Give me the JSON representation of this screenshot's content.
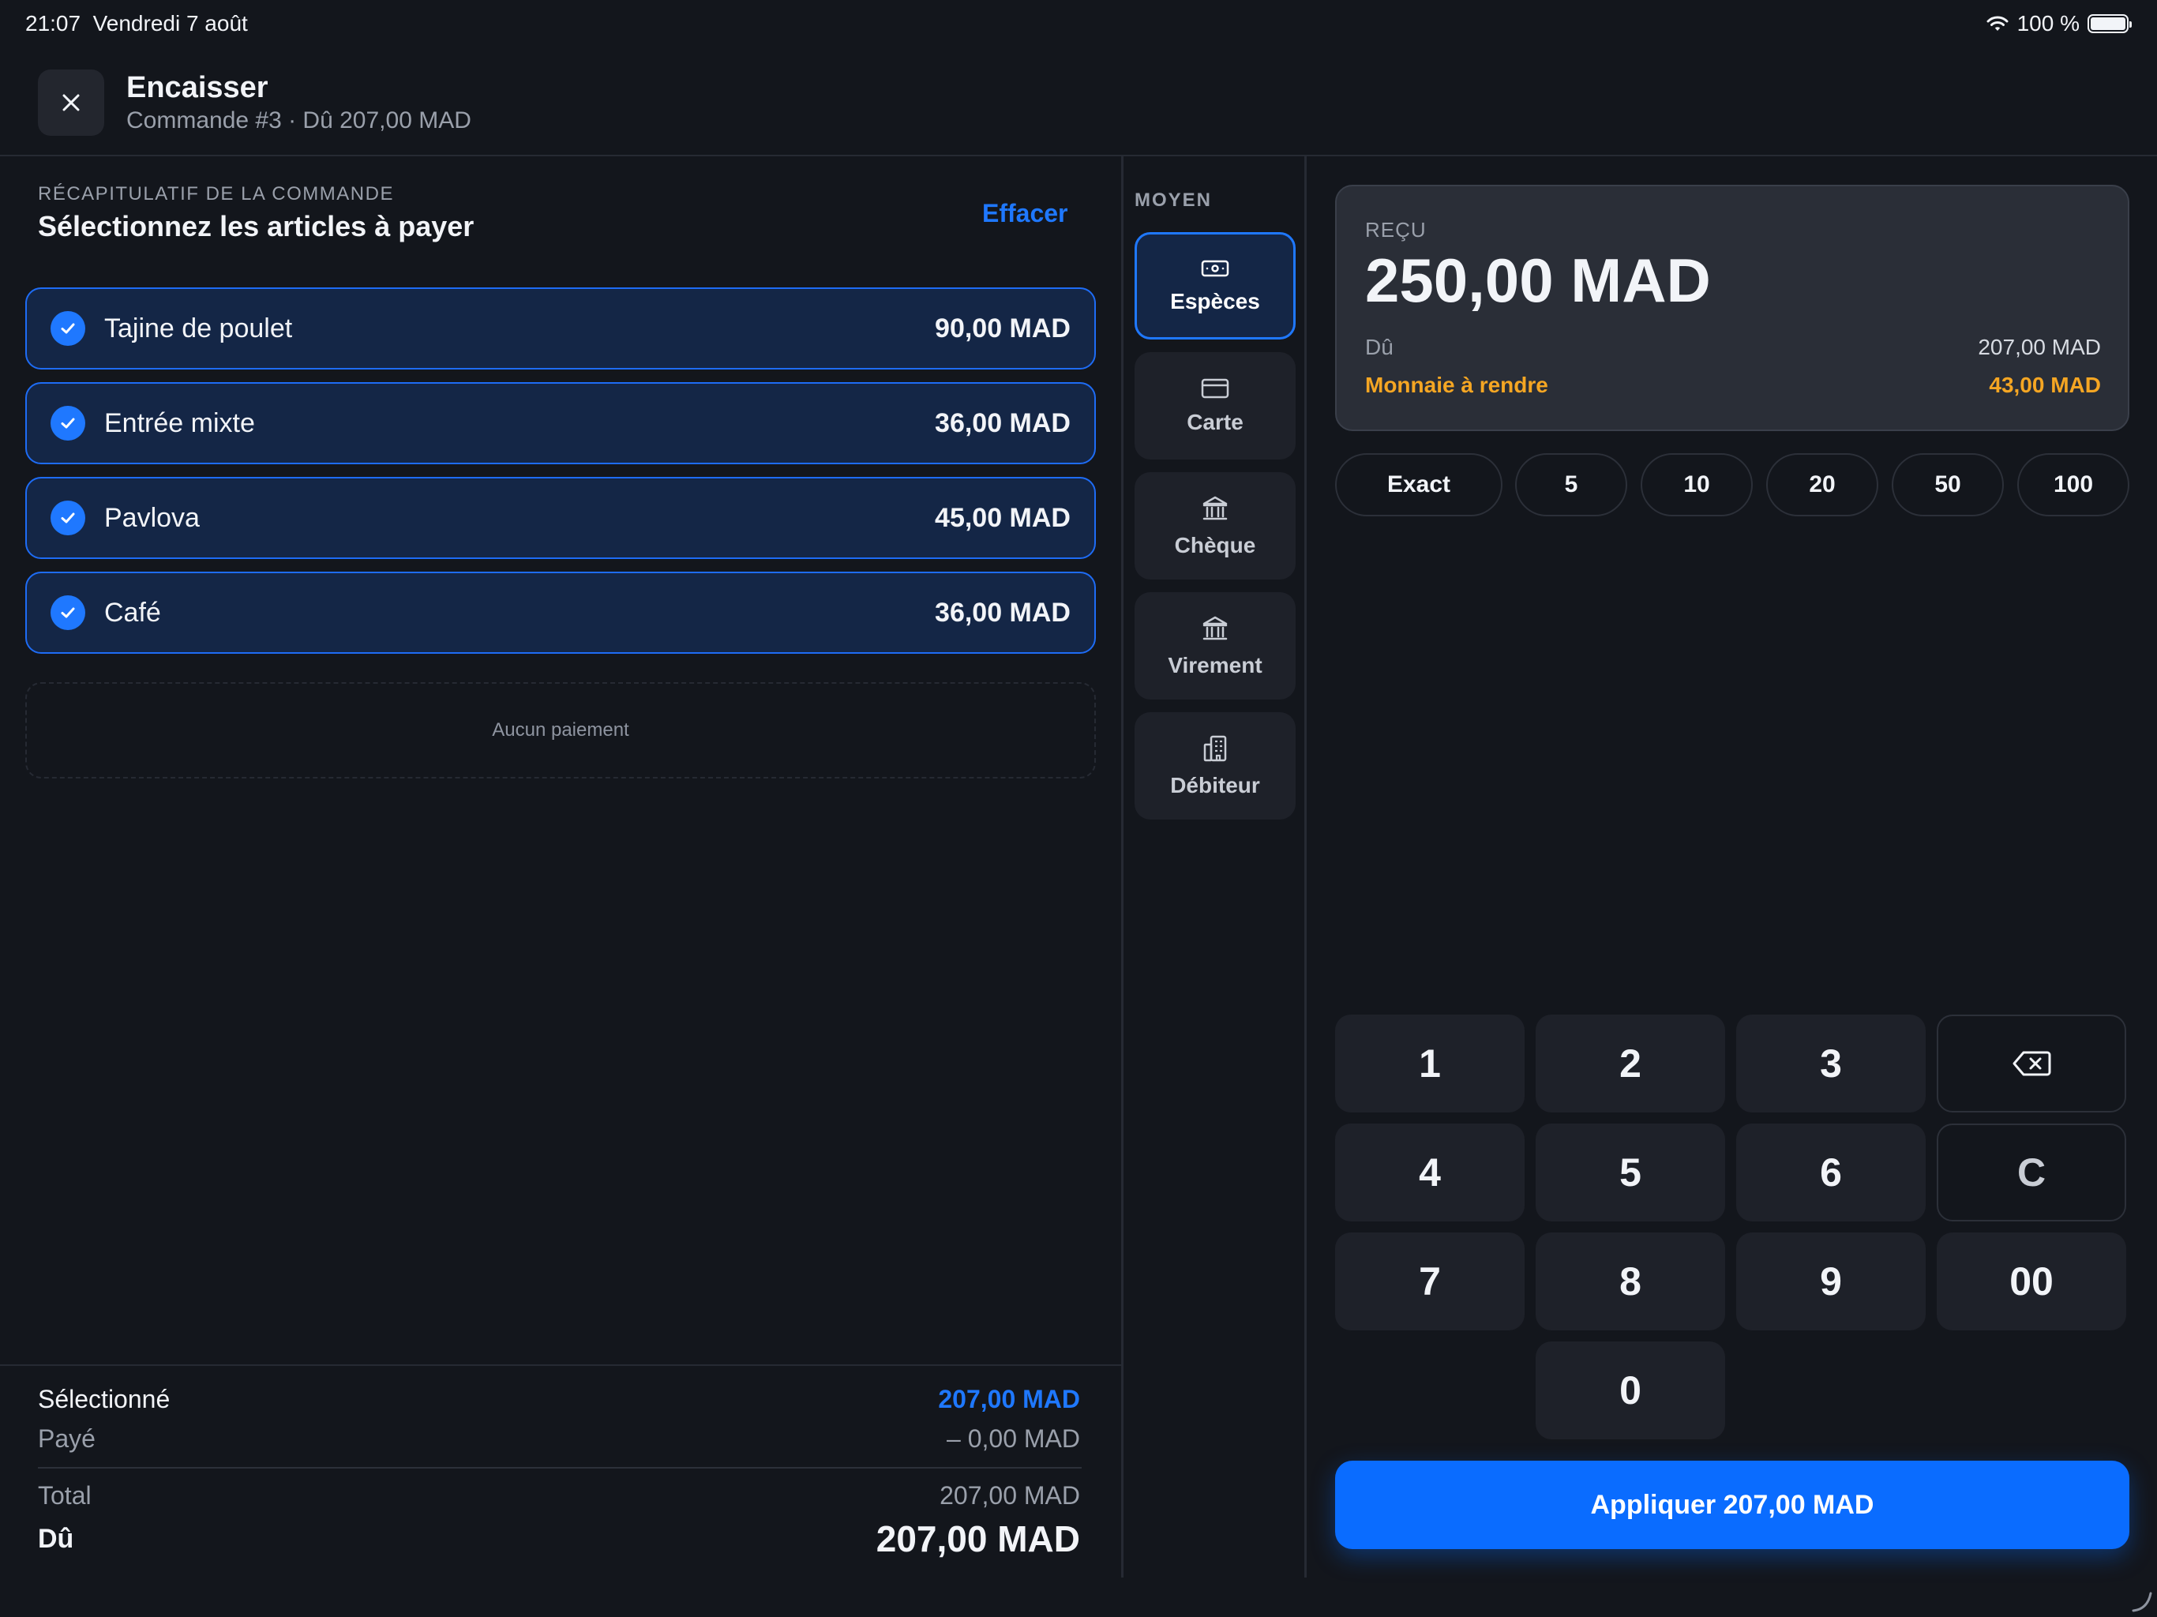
{
  "status_bar": {
    "time": "21:07",
    "date": "Vendredi 7 août",
    "battery": "100 %"
  },
  "header": {
    "title": "Encaisser",
    "subtitle": "Commande #3 · Dû 207,00 MAD"
  },
  "summary": {
    "label": "RÉCAPITULATIF DE LA COMMANDE",
    "title": "Sélectionnez les articles à payer",
    "clear": "Effacer",
    "items": [
      {
        "name": "Tajine de poulet",
        "price": "90,00 MAD",
        "selected": true
      },
      {
        "name": "Entrée mixte",
        "price": "36,00 MAD",
        "selected": true
      },
      {
        "name": "Pavlova",
        "price": "45,00 MAD",
        "selected": true
      },
      {
        "name": "Café",
        "price": "36,00 MAD",
        "selected": true
      }
    ],
    "no_payment": "Aucun paiement"
  },
  "totals": {
    "selected_label": "Sélectionné",
    "selected_value": "207,00 MAD",
    "paid_label": "Payé",
    "paid_value": "– 0,00 MAD",
    "total_label": "Total",
    "total_value": "207,00 MAD",
    "due_label": "Dû",
    "due_value": "207,00 MAD"
  },
  "methods": {
    "label": "MOYEN",
    "items": [
      {
        "label": "Espèces",
        "icon": "cash-icon",
        "active": true
      },
      {
        "label": "Carte",
        "icon": "card-icon",
        "active": false
      },
      {
        "label": "Chèque",
        "icon": "bank-icon",
        "active": false
      },
      {
        "label": "Virement",
        "icon": "bank-icon",
        "active": false
      },
      {
        "label": "Débiteur",
        "icon": "building-icon",
        "active": false
      }
    ]
  },
  "received": {
    "label": "REÇU",
    "amount": "250,00 MAD",
    "due_label": "Dû",
    "due_value": "207,00 MAD",
    "change_label": "Monnaie à rendre",
    "change_value": "43,00 MAD"
  },
  "quick_amounts": [
    "Exact",
    "5",
    "10",
    "20",
    "50",
    "100"
  ],
  "keypad": {
    "keys": [
      "1",
      "2",
      "3",
      "4",
      "5",
      "6",
      "7",
      "8",
      "9",
      "00",
      "0"
    ],
    "clear": "C",
    "backspace_icon": "backspace-icon"
  },
  "apply_button": "Appliquer 207,00 MAD",
  "colors": {
    "accent": "#1f78ff",
    "change": "#f5a623",
    "background": "#13161c",
    "selected_item_bg": "#142646"
  }
}
